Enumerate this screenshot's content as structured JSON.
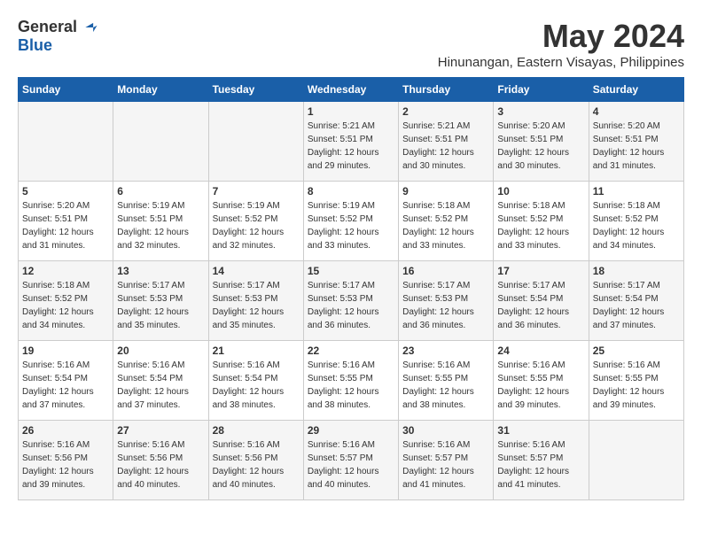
{
  "logo": {
    "general": "General",
    "blue": "Blue"
  },
  "title": "May 2024",
  "location": "Hinunangan, Eastern Visayas, Philippines",
  "days_of_week": [
    "Sunday",
    "Monday",
    "Tuesday",
    "Wednesday",
    "Thursday",
    "Friday",
    "Saturday"
  ],
  "weeks": [
    [
      {
        "day": "",
        "sunrise": "",
        "sunset": "",
        "daylight": ""
      },
      {
        "day": "",
        "sunrise": "",
        "sunset": "",
        "daylight": ""
      },
      {
        "day": "",
        "sunrise": "",
        "sunset": "",
        "daylight": ""
      },
      {
        "day": "1",
        "sunrise": "Sunrise: 5:21 AM",
        "sunset": "Sunset: 5:51 PM",
        "daylight": "Daylight: 12 hours and 29 minutes."
      },
      {
        "day": "2",
        "sunrise": "Sunrise: 5:21 AM",
        "sunset": "Sunset: 5:51 PM",
        "daylight": "Daylight: 12 hours and 30 minutes."
      },
      {
        "day": "3",
        "sunrise": "Sunrise: 5:20 AM",
        "sunset": "Sunset: 5:51 PM",
        "daylight": "Daylight: 12 hours and 30 minutes."
      },
      {
        "day": "4",
        "sunrise": "Sunrise: 5:20 AM",
        "sunset": "Sunset: 5:51 PM",
        "daylight": "Daylight: 12 hours and 31 minutes."
      }
    ],
    [
      {
        "day": "5",
        "sunrise": "Sunrise: 5:20 AM",
        "sunset": "Sunset: 5:51 PM",
        "daylight": "Daylight: 12 hours and 31 minutes."
      },
      {
        "day": "6",
        "sunrise": "Sunrise: 5:19 AM",
        "sunset": "Sunset: 5:51 PM",
        "daylight": "Daylight: 12 hours and 32 minutes."
      },
      {
        "day": "7",
        "sunrise": "Sunrise: 5:19 AM",
        "sunset": "Sunset: 5:52 PM",
        "daylight": "Daylight: 12 hours and 32 minutes."
      },
      {
        "day": "8",
        "sunrise": "Sunrise: 5:19 AM",
        "sunset": "Sunset: 5:52 PM",
        "daylight": "Daylight: 12 hours and 33 minutes."
      },
      {
        "day": "9",
        "sunrise": "Sunrise: 5:18 AM",
        "sunset": "Sunset: 5:52 PM",
        "daylight": "Daylight: 12 hours and 33 minutes."
      },
      {
        "day": "10",
        "sunrise": "Sunrise: 5:18 AM",
        "sunset": "Sunset: 5:52 PM",
        "daylight": "Daylight: 12 hours and 33 minutes."
      },
      {
        "day": "11",
        "sunrise": "Sunrise: 5:18 AM",
        "sunset": "Sunset: 5:52 PM",
        "daylight": "Daylight: 12 hours and 34 minutes."
      }
    ],
    [
      {
        "day": "12",
        "sunrise": "Sunrise: 5:18 AM",
        "sunset": "Sunset: 5:52 PM",
        "daylight": "Daylight: 12 hours and 34 minutes."
      },
      {
        "day": "13",
        "sunrise": "Sunrise: 5:17 AM",
        "sunset": "Sunset: 5:53 PM",
        "daylight": "Daylight: 12 hours and 35 minutes."
      },
      {
        "day": "14",
        "sunrise": "Sunrise: 5:17 AM",
        "sunset": "Sunset: 5:53 PM",
        "daylight": "Daylight: 12 hours and 35 minutes."
      },
      {
        "day": "15",
        "sunrise": "Sunrise: 5:17 AM",
        "sunset": "Sunset: 5:53 PM",
        "daylight": "Daylight: 12 hours and 36 minutes."
      },
      {
        "day": "16",
        "sunrise": "Sunrise: 5:17 AM",
        "sunset": "Sunset: 5:53 PM",
        "daylight": "Daylight: 12 hours and 36 minutes."
      },
      {
        "day": "17",
        "sunrise": "Sunrise: 5:17 AM",
        "sunset": "Sunset: 5:54 PM",
        "daylight": "Daylight: 12 hours and 36 minutes."
      },
      {
        "day": "18",
        "sunrise": "Sunrise: 5:17 AM",
        "sunset": "Sunset: 5:54 PM",
        "daylight": "Daylight: 12 hours and 37 minutes."
      }
    ],
    [
      {
        "day": "19",
        "sunrise": "Sunrise: 5:16 AM",
        "sunset": "Sunset: 5:54 PM",
        "daylight": "Daylight: 12 hours and 37 minutes."
      },
      {
        "day": "20",
        "sunrise": "Sunrise: 5:16 AM",
        "sunset": "Sunset: 5:54 PM",
        "daylight": "Daylight: 12 hours and 37 minutes."
      },
      {
        "day": "21",
        "sunrise": "Sunrise: 5:16 AM",
        "sunset": "Sunset: 5:54 PM",
        "daylight": "Daylight: 12 hours and 38 minutes."
      },
      {
        "day": "22",
        "sunrise": "Sunrise: 5:16 AM",
        "sunset": "Sunset: 5:55 PM",
        "daylight": "Daylight: 12 hours and 38 minutes."
      },
      {
        "day": "23",
        "sunrise": "Sunrise: 5:16 AM",
        "sunset": "Sunset: 5:55 PM",
        "daylight": "Daylight: 12 hours and 38 minutes."
      },
      {
        "day": "24",
        "sunrise": "Sunrise: 5:16 AM",
        "sunset": "Sunset: 5:55 PM",
        "daylight": "Daylight: 12 hours and 39 minutes."
      },
      {
        "day": "25",
        "sunrise": "Sunrise: 5:16 AM",
        "sunset": "Sunset: 5:55 PM",
        "daylight": "Daylight: 12 hours and 39 minutes."
      }
    ],
    [
      {
        "day": "26",
        "sunrise": "Sunrise: 5:16 AM",
        "sunset": "Sunset: 5:56 PM",
        "daylight": "Daylight: 12 hours and 39 minutes."
      },
      {
        "day": "27",
        "sunrise": "Sunrise: 5:16 AM",
        "sunset": "Sunset: 5:56 PM",
        "daylight": "Daylight: 12 hours and 40 minutes."
      },
      {
        "day": "28",
        "sunrise": "Sunrise: 5:16 AM",
        "sunset": "Sunset: 5:56 PM",
        "daylight": "Daylight: 12 hours and 40 minutes."
      },
      {
        "day": "29",
        "sunrise": "Sunrise: 5:16 AM",
        "sunset": "Sunset: 5:57 PM",
        "daylight": "Daylight: 12 hours and 40 minutes."
      },
      {
        "day": "30",
        "sunrise": "Sunrise: 5:16 AM",
        "sunset": "Sunset: 5:57 PM",
        "daylight": "Daylight: 12 hours and 41 minutes."
      },
      {
        "day": "31",
        "sunrise": "Sunrise: 5:16 AM",
        "sunset": "Sunset: 5:57 PM",
        "daylight": "Daylight: 12 hours and 41 minutes."
      },
      {
        "day": "",
        "sunrise": "",
        "sunset": "",
        "daylight": ""
      }
    ]
  ]
}
